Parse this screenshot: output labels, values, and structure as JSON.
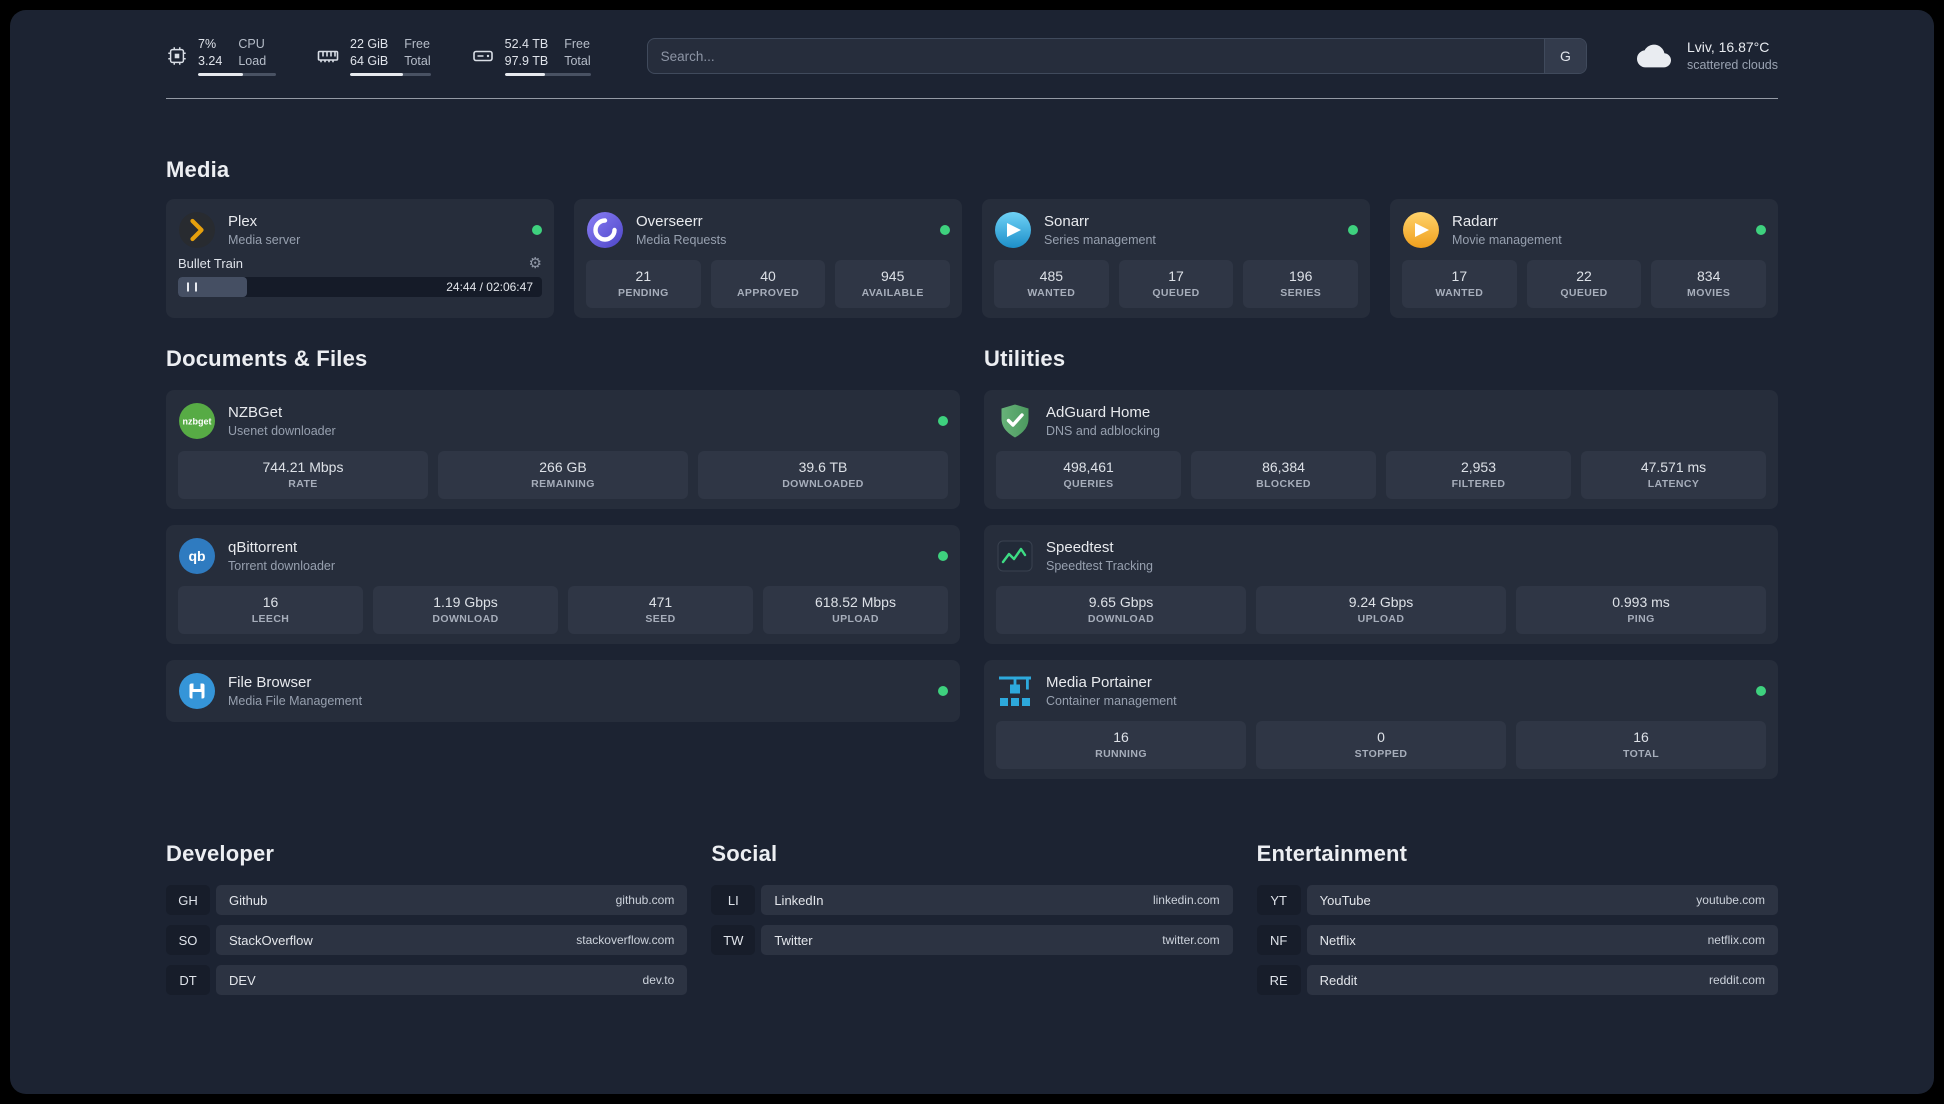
{
  "colors": {
    "background": "#1c2332",
    "card": "#262d3b",
    "stat_box": "#2f3645",
    "status_online": "#3ed17e",
    "plex_accent": "#e5a00d",
    "speedtest_line": "#3ddc84"
  },
  "topbar": {
    "resources": [
      {
        "icon": "cpu-icon",
        "values": [
          "7%",
          "3.24"
        ],
        "labels": [
          "CPU",
          "Load"
        ],
        "bar_style": "width:58%"
      },
      {
        "icon": "memory-icon",
        "values": [
          "22 GiB",
          "64 GiB"
        ],
        "labels": [
          "Free",
          "Total"
        ],
        "bar_style": "width:66%"
      },
      {
        "icon": "disk-icon",
        "values": [
          "52.4 TB",
          "97.9 TB"
        ],
        "labels": [
          "Free",
          "Total"
        ],
        "bar_style": "width:47%"
      }
    ],
    "search": {
      "placeholder": "Search...",
      "provider": "G"
    },
    "weather": {
      "location": "Lviv, 16.87°C",
      "condition": "scattered clouds"
    }
  },
  "sections": {
    "media": "Media",
    "documents": "Documents & Files",
    "utilities": "Utilities"
  },
  "icons": {
    "nzbget_text": "nzbget",
    "qbittorrent_text": "qb"
  },
  "services": {
    "plex": {
      "name": "Plex",
      "description": "Media server",
      "icon": "plex-icon",
      "status": "online",
      "now_playing": {
        "title": "Bullet Train",
        "time": "24:44 / 02:06:47",
        "progress_style": "width:19%"
      }
    },
    "overseerr": {
      "name": "Overseerr",
      "description": "Media Requests",
      "icon": "overseerr-icon",
      "status": "online",
      "stats": [
        {
          "value": "21",
          "label": "PENDING"
        },
        {
          "value": "40",
          "label": "APPROVED"
        },
        {
          "value": "945",
          "label": "AVAILABLE"
        }
      ]
    },
    "sonarr": {
      "name": "Sonarr",
      "description": "Series management",
      "icon": "sonarr-icon",
      "status": "online",
      "stats": [
        {
          "value": "485",
          "label": "WANTED"
        },
        {
          "value": "17",
          "label": "QUEUED"
        },
        {
          "value": "196",
          "label": "SERIES"
        }
      ]
    },
    "radarr": {
      "name": "Radarr",
      "description": "Movie management",
      "icon": "radarr-icon",
      "status": "online",
      "stats": [
        {
          "value": "17",
          "label": "WANTED"
        },
        {
          "value": "22",
          "label": "QUEUED"
        },
        {
          "value": "834",
          "label": "MOVIES"
        }
      ]
    },
    "nzbget": {
      "name": "NZBGet",
      "description": "Usenet downloader",
      "icon": "nzbget-icon",
      "status": "online",
      "stats": [
        {
          "value": "744.21 Mbps",
          "label": "RATE"
        },
        {
          "value": "266 GB",
          "label": "REMAINING"
        },
        {
          "value": "39.6 TB",
          "label": "DOWNLOADED"
        }
      ]
    },
    "qbittorrent": {
      "name": "qBittorrent",
      "description": "Torrent downloader",
      "icon": "qbittorrent-icon",
      "status": "online",
      "stats": [
        {
          "value": "16",
          "label": "LEECH"
        },
        {
          "value": "1.19 Gbps",
          "label": "DOWNLOAD"
        },
        {
          "value": "471",
          "label": "SEED"
        },
        {
          "value": "618.52 Mbps",
          "label": "UPLOAD"
        }
      ]
    },
    "filebrowser": {
      "name": "File Browser",
      "description": "Media File Management",
      "icon": "filebrowser-icon",
      "status": "online"
    },
    "adguard": {
      "name": "AdGuard Home",
      "description": "DNS and adblocking",
      "icon": "adguard-icon",
      "stats": [
        {
          "value": "498,461",
          "label": "QUERIES"
        },
        {
          "value": "86,384",
          "label": "BLOCKED"
        },
        {
          "value": "2,953",
          "label": "FILTERED"
        },
        {
          "value": "47.571 ms",
          "label": "LATENCY"
        }
      ]
    },
    "speedtest": {
      "name": "Speedtest",
      "description": "Speedtest Tracking",
      "icon": "speedtest-icon",
      "stats": [
        {
          "value": "9.65 Gbps",
          "label": "DOWNLOAD"
        },
        {
          "value": "9.24 Gbps",
          "label": "UPLOAD"
        },
        {
          "value": "0.993 ms",
          "label": "PING"
        }
      ]
    },
    "portainer": {
      "name": "Media Portainer",
      "description": "Container management",
      "icon": "portainer-icon",
      "status": "online",
      "stats": [
        {
          "value": "16",
          "label": "RUNNING"
        },
        {
          "value": "0",
          "label": "STOPPED"
        },
        {
          "value": "16",
          "label": "TOTAL"
        }
      ]
    }
  },
  "bookmarks": [
    {
      "title": "Developer",
      "items": [
        {
          "abbr": "GH",
          "name": "Github",
          "domain": "github.com"
        },
        {
          "abbr": "SO",
          "name": "StackOverflow",
          "domain": "stackoverflow.com"
        },
        {
          "abbr": "DT",
          "name": "DEV",
          "domain": "dev.to"
        }
      ]
    },
    {
      "title": "Social",
      "items": [
        {
          "abbr": "LI",
          "name": "LinkedIn",
          "domain": "linkedin.com"
        },
        {
          "abbr": "TW",
          "name": "Twitter",
          "domain": "twitter.com"
        }
      ]
    },
    {
      "title": "Entertainment",
      "items": [
        {
          "abbr": "YT",
          "name": "YouTube",
          "domain": "youtube.com"
        },
        {
          "abbr": "NF",
          "name": "Netflix",
          "domain": "netflix.com"
        },
        {
          "abbr": "RE",
          "name": "Reddit",
          "domain": "reddit.com"
        }
      ]
    }
  ]
}
